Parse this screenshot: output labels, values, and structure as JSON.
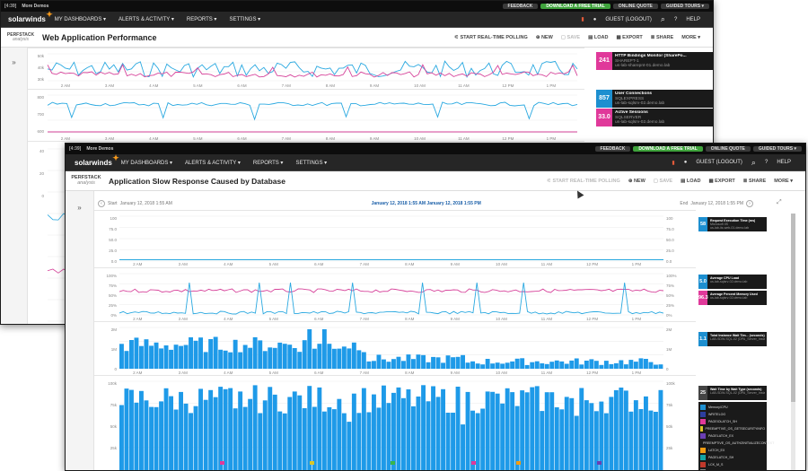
{
  "back": {
    "topbar": {
      "left": "[4:39]",
      "app": "More Demos",
      "buttons": [
        "FEEDBACK",
        "DOWNLOAD A FREE TRIAL",
        "ONLINE QUOTE",
        "GUIDED TOURS ▾"
      ]
    },
    "nav": {
      "logo": "solarwinds",
      "items": [
        "MY DASHBOARDS ▾",
        "ALERTS & ACTIVITY ▾",
        "REPORTS ▾",
        "SETTINGS ▾"
      ],
      "user": "GUEST (LOGOUT)",
      "help": "HELP"
    },
    "perfstack": "PERFSTACK",
    "analysis": "analysis",
    "title": "Web Application Performance",
    "actions": {
      "polling": "START REAL-TIME POLLING",
      "new": "NEW",
      "save": "SAVE",
      "load": "LOAD",
      "export": "EXPORT",
      "share": "SHARE",
      "more": "MORE ▾"
    },
    "left_icon": "»",
    "axis1": [
      "50k",
      "40k",
      "30k"
    ],
    "axis2": [
      "800",
      "700",
      "600"
    ],
    "axis3": [
      "40",
      "20",
      "0"
    ],
    "xlabels": [
      "2 AM",
      "3 AM",
      "4 AM",
      "5 AM",
      "6 AM",
      "7 AM",
      "8 AM",
      "9 AM",
      "10 AM",
      "11 AM",
      "12 PM",
      "1 PM"
    ],
    "cards": [
      {
        "value": "241",
        "color": "#e0399a",
        "title": "HTTP Bindings Monitor (SharePo...",
        "line2": "SHAREPT-1",
        "line3": "us-lab-sharepnt-01.demo.lab"
      },
      {
        "value": "857",
        "color": "#1d8fd0",
        "title": "User Connections",
        "line2": "SQLEXPRESS",
        "line3": "us-lab-sqlsrv-02.demo.lab"
      },
      {
        "value": "33.0",
        "color": "#e0399a",
        "title": "Active Sessions",
        "line2": "SQLSERVER",
        "line3": "us-lab-sqlsrv-02.demo.lab"
      }
    ]
  },
  "front": {
    "topbar": {
      "left": "[4:39]",
      "app": "More Demos",
      "buttons": [
        "FEEDBACK",
        "DOWNLOAD A FREE TRIAL",
        "ONLINE QUOTE",
        "GUIDED TOURS ▾"
      ]
    },
    "nav": {
      "logo": "solarwinds",
      "items": [
        "MY DASHBOARDS ▾",
        "ALERTS & ACTIVITY ▾",
        "REPORTS ▾",
        "SETTINGS ▾"
      ],
      "user": "GUEST (LOGOUT)",
      "help": "HELP"
    },
    "perfstack": "PERFSTACK",
    "analysis": "analysis",
    "title": "Application Slow Response Caused by Database",
    "actions": {
      "polling": "START REAL-TIME POLLING",
      "new": "NEW",
      "save": "SAVE",
      "load": "LOAD",
      "export": "EXPORT",
      "share": "SHARE",
      "more": "MORE ▾"
    },
    "left_icon": "»",
    "range": {
      "start_label": "Start",
      "start": "January 12, 2018 1:55 AM",
      "center": "January 12, 2018 1:55 AM  January 12, 2018 1:55 PM",
      "end_label": "End",
      "end": "January 12, 2018 1:55 PM"
    },
    "xlabels": [
      "2 AM",
      "3 AM",
      "4 AM",
      "5 AM",
      "6 AM",
      "7 AM",
      "8 AM",
      "9 AM",
      "10 AM",
      "11 AM",
      "12 PM",
      "1 PM"
    ],
    "axis1": [
      "100",
      "75.0",
      "50.0",
      "25.0",
      "0.0"
    ],
    "axis2": [
      "100%",
      "75%",
      "50%",
      "25%",
      "0%"
    ],
    "axis3": [
      "2M",
      "1M",
      "0"
    ],
    "axis4": [
      "100k",
      "75k",
      "50k",
      "25k"
    ],
    "cards": [
      {
        "value": "58",
        "color": "#1d8fd0",
        "title": "Request Execution Time (ms)",
        "line2": "Microsoft IIS",
        "line3": "us-lab-iis-web-01.demo.lab"
      },
      {
        "value": "5.0",
        "color": "#1d8fd0",
        "title": "Average CPU Load",
        "line2": "us-lab-sqlsrv-02.demo.lab",
        "line3": ""
      },
      {
        "value": "96.3",
        "color": "#e0399a",
        "title": "Average Percent Memory Used",
        "line2": "us-lab-sqlsrv-02.demo.lab",
        "line3": ""
      },
      {
        "value": "1.1",
        "color": "#1d8fd0",
        "title": "Total Instance Wait Tim... (seconds)",
        "line2": "LAB-SDW-SQL-02 (DPA_Server_Instance)",
        "line3": ""
      },
      {
        "value": "25",
        "color": "#444444",
        "title": "Wait Time by Wait Type (seconds)",
        "line2": "LAB-SDW-SQL-02 (DPA_Server_Instance)",
        "line3": ""
      }
    ],
    "wait_types": [
      {
        "name": "Memory/CPU",
        "color": "#1d8fd0"
      },
      {
        "name": "WRITELOG",
        "color": "#2c3e9e"
      },
      {
        "name": "PAGEIOLATCH_SH",
        "color": "#e0399a"
      },
      {
        "name": "PREEMPTIVE_OS_GETSECURITYINFO",
        "color": "#d9c628"
      },
      {
        "name": "PAGELATCH_EX",
        "color": "#6a3fb3"
      },
      {
        "name": "PREEMPTIVE_OS_AUTHZINITIALIZECONTEXT",
        "color": "#39b54a"
      },
      {
        "name": "LATCH_EX",
        "color": "#f39c12"
      },
      {
        "name": "PAGELATCH_SH",
        "color": "#16a5a5"
      },
      {
        "name": "LCK_M_S",
        "color": "#c0392b"
      },
      {
        "name": "All others",
        "color": "#888888"
      }
    ]
  },
  "colors": {
    "blue": "#29a8e0",
    "pink": "#d6439a",
    "green": "#3fa33c",
    "orange": "#f89a1c"
  }
}
